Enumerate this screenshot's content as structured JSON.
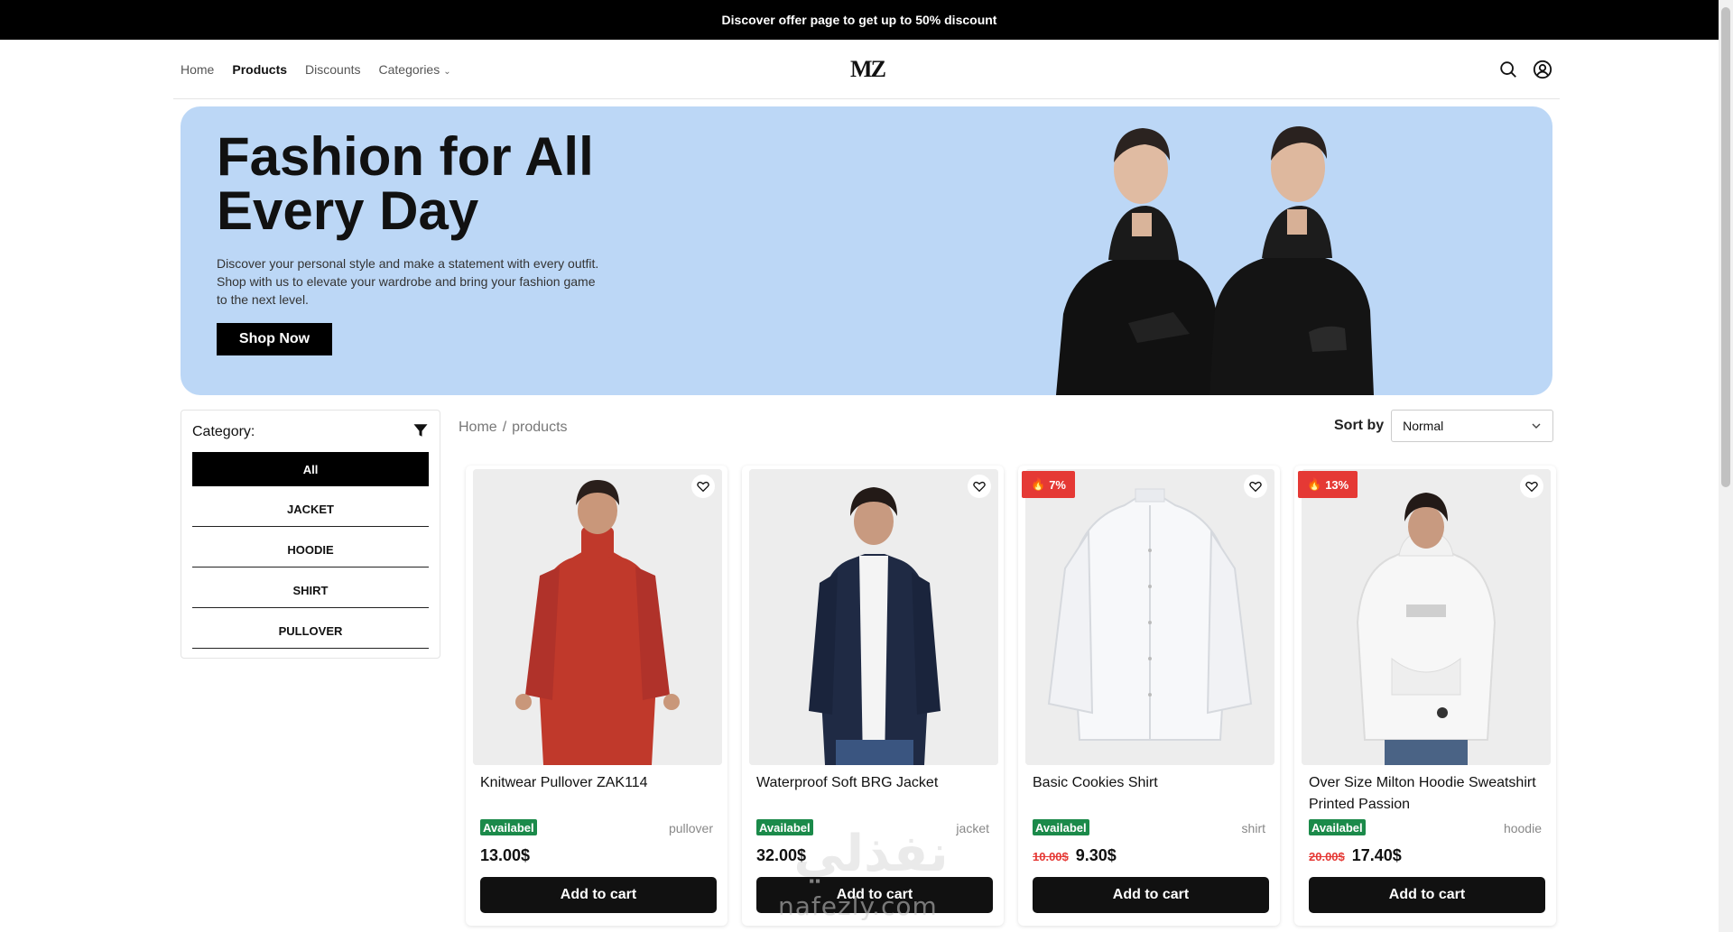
{
  "promo": {
    "text": "Discover offer page to get up to 50% discount"
  },
  "header": {
    "nav": [
      "Home",
      "Products",
      "Discounts",
      "Categories"
    ],
    "logo": "MZ"
  },
  "hero": {
    "title": "Fashion for All Every Day",
    "description": "Discover your personal style and make a statement with every outfit. Shop with us to elevate your wardrobe and bring your fashion game to the next level.",
    "cta": "Shop Now"
  },
  "sidebar": {
    "title": "Category:",
    "categories": [
      "All",
      "JACKET",
      "HOODIE",
      "SHIRT",
      "PULLOVER"
    ],
    "selected": "All"
  },
  "breadcrumb": {
    "home": "Home",
    "sep": "/",
    "current": "products"
  },
  "sort": {
    "label": "Sort by",
    "value": "Normal"
  },
  "products": [
    {
      "name": "Knitwear Pullover ZAK114",
      "status": "Availabel",
      "category": "pullover",
      "price": "13.00$",
      "old_price": "",
      "discount": "",
      "button": "Add to cart",
      "color": "#c0392b"
    },
    {
      "name": "Waterproof Soft BRG Jacket",
      "status": "Availabel",
      "category": "jacket",
      "price": "32.00$",
      "old_price": "",
      "discount": "",
      "button": "Add to cart",
      "color": "#1f2a44"
    },
    {
      "name": "Basic Cookies Shirt",
      "status": "Availabel",
      "category": "shirt",
      "price": "9.30$",
      "old_price": "10.00$",
      "discount": "7%",
      "button": "Add to cart",
      "color": "#f4f5f7"
    },
    {
      "name": "Over Size Milton Hoodie Sweatshirt Printed Passion",
      "status": "Availabel",
      "category": "hoodie",
      "price": "17.40$",
      "old_price": "20.00$",
      "discount": "13%",
      "button": "Add to cart",
      "color": "#f0f0f0"
    }
  ],
  "watermark": {
    "arabic": "نفذلي",
    "latin": "nafezly.com"
  },
  "colors": {
    "hero_bg": "#bcd7f6",
    "available": "#1b8a4a",
    "discount": "#e53935",
    "button": "#111111"
  }
}
